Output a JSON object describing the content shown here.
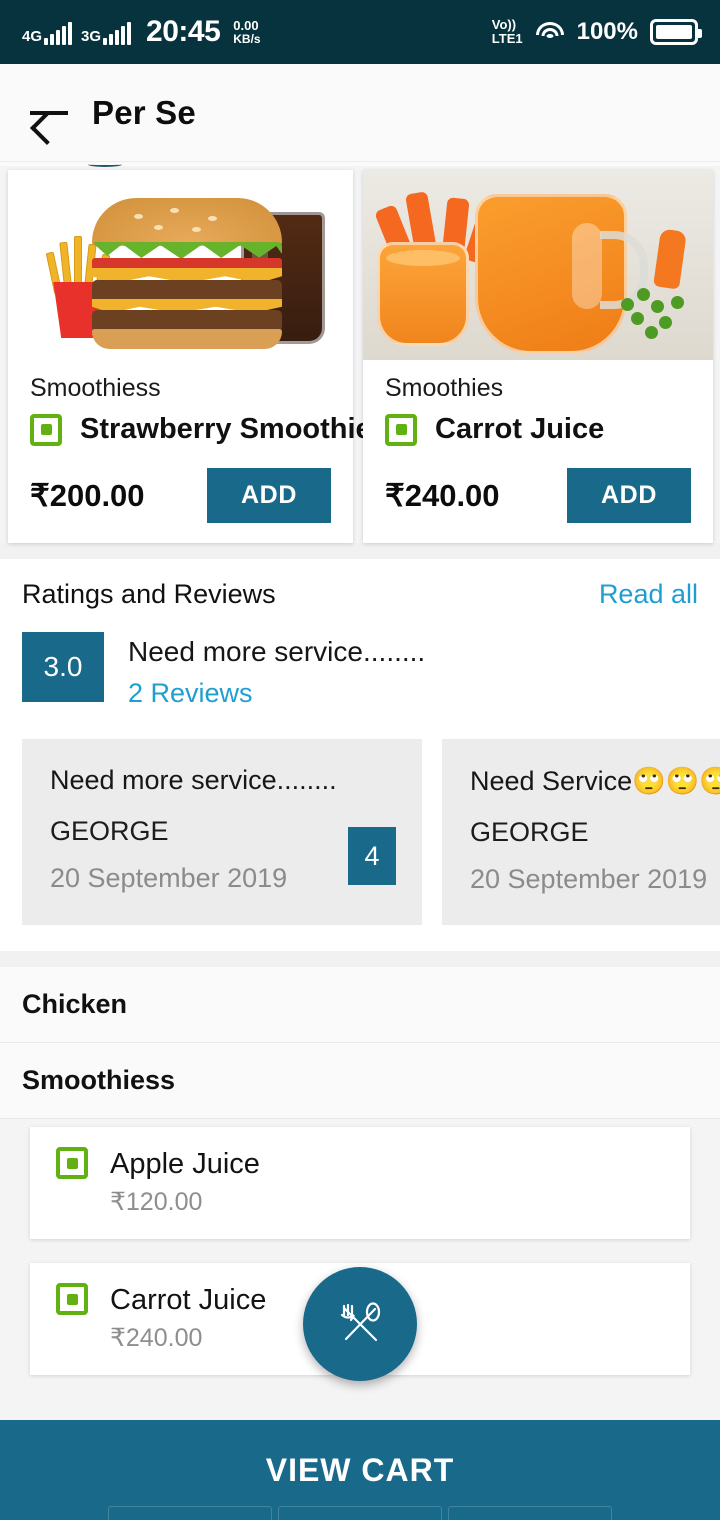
{
  "status_bar": {
    "net_gen_1": "4G",
    "net_gen_2": "3G",
    "clock": "20:45",
    "speed_value": "0.00",
    "speed_unit": "KB/s",
    "volte_top": "Vo))",
    "volte_bottom": "LTE1",
    "battery_percent": "100%"
  },
  "app_bar": {
    "title": "Per Se"
  },
  "featured": {
    "cards": [
      {
        "category": "Smoothiess",
        "name": "Strawberry Smoothie",
        "price": "₹200.00",
        "add_label": "ADD",
        "image": "burger-fries-cola-photo"
      },
      {
        "category": "Smoothies",
        "name": "Carrot Juice",
        "price": "₹240.00",
        "add_label": "ADD",
        "image": "carrot-juice-pitcher-photo"
      }
    ]
  },
  "ratings": {
    "title": "Ratings and Reviews",
    "read_all": "Read all",
    "score": "3.0",
    "highlight_quote": "Need more service........",
    "reviews_count": "2 Reviews",
    "reviews": [
      {
        "text": "Need more service........",
        "user": "GEORGE",
        "date": "20 September 2019",
        "score": "4"
      },
      {
        "text": "Need Service🙄🙄🙄.",
        "user": "GEORGE",
        "date": "20 September 2019",
        "score": ""
      }
    ]
  },
  "menu": {
    "sections": [
      {
        "title": "Chicken",
        "items": []
      },
      {
        "title": "Smoothiess",
        "items": [
          {
            "name": "Apple Juice",
            "price": "₹120.00"
          },
          {
            "name": "Carrot Juice",
            "price": "₹240.00"
          }
        ]
      }
    ]
  },
  "fab": {
    "icon": "fork-spoon-icon"
  },
  "cart_bar": {
    "label": "VIEW CART"
  },
  "colors": {
    "status_bar": "#06333d",
    "accent_teal": "#18698a",
    "link_blue": "#1f9fd0",
    "veg_green": "#62b112"
  }
}
